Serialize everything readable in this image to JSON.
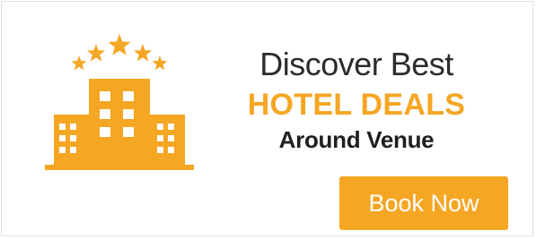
{
  "ad": {
    "line1": "Discover Best",
    "line2": "HOTEL DEALS",
    "line3": "Around Venue",
    "button_label": "Book Now"
  },
  "icons": {
    "hotel": "hotel-buildings-with-stars-icon"
  },
  "colors": {
    "accent": "#f5a623",
    "text_dark": "#2b2b2b",
    "background": "#ffffff",
    "border": "#e2e2e2"
  }
}
